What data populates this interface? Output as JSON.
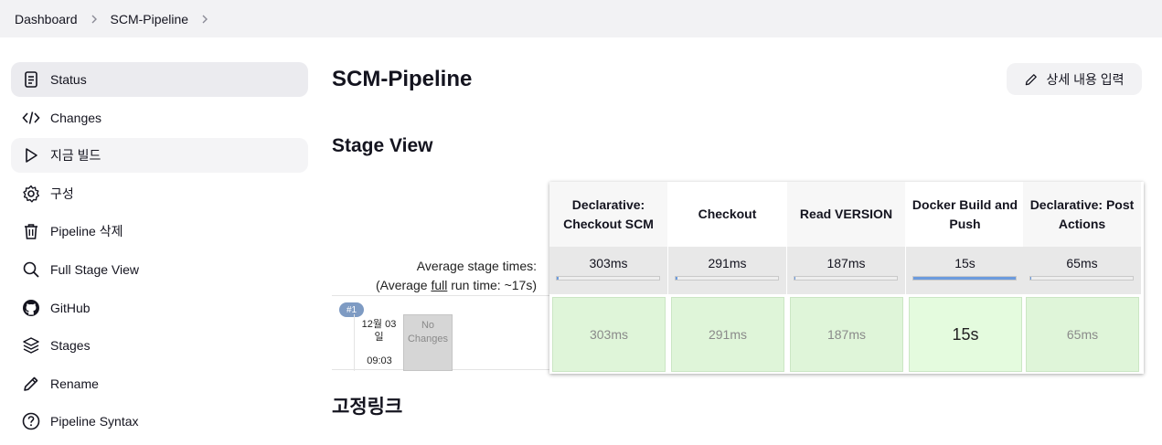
{
  "breadcrumb": {
    "items": [
      "Dashboard",
      "SCM-Pipeline"
    ]
  },
  "sidebar": {
    "items": [
      {
        "label": "Status",
        "icon": "document-icon"
      },
      {
        "label": "Changes",
        "icon": "code-icon"
      },
      {
        "label": "지금 빌드",
        "icon": "play-icon"
      },
      {
        "label": "구성",
        "icon": "gear-icon"
      },
      {
        "label": "Pipeline 삭제",
        "icon": "trash-icon"
      },
      {
        "label": "Full Stage View",
        "icon": "search-icon"
      },
      {
        "label": "GitHub",
        "icon": "github-icon"
      },
      {
        "label": "Stages",
        "icon": "layers-icon"
      },
      {
        "label": "Rename",
        "icon": "pencil-icon"
      },
      {
        "label": "Pipeline Syntax",
        "icon": "help-icon"
      }
    ]
  },
  "main": {
    "title": "SCM-Pipeline",
    "edit_label": "상세 내용 입력",
    "stage_view_title": "Stage View",
    "permalinks_title": "고정링크"
  },
  "stage_view": {
    "avg_label_line1": "Average stage times:",
    "avg_label_prefix": "(Average ",
    "avg_label_full": "full",
    "avg_label_suffix": " run time: ~17s)",
    "stages": [
      {
        "name": "Declarative: Checkout SCM",
        "avg": "303ms",
        "avg_fraction": 0.02,
        "run": "303ms"
      },
      {
        "name": "Checkout",
        "avg": "291ms",
        "avg_fraction": 0.02,
        "run": "291ms"
      },
      {
        "name": "Read VERSION",
        "avg": "187ms",
        "avg_fraction": 0.01,
        "run": "187ms"
      },
      {
        "name": "Docker Build and Push",
        "avg": "15s",
        "avg_fraction": 1.0,
        "run": "15s"
      },
      {
        "name": "Declarative: Post Actions",
        "avg": "65ms",
        "avg_fraction": 0.01,
        "run": "65ms"
      }
    ],
    "build": {
      "number": "#1",
      "date_line1": "12월 03",
      "date_line2": "일",
      "time": "09:03",
      "no_changes_line1": "No",
      "no_changes_line2": "Changes"
    }
  },
  "colors": {
    "sidebar_active": "#ebebef",
    "stage_success": "#dff5d9",
    "avg_bar_fill": "#6c9bdd",
    "build_badge": "#7e9bc3"
  }
}
